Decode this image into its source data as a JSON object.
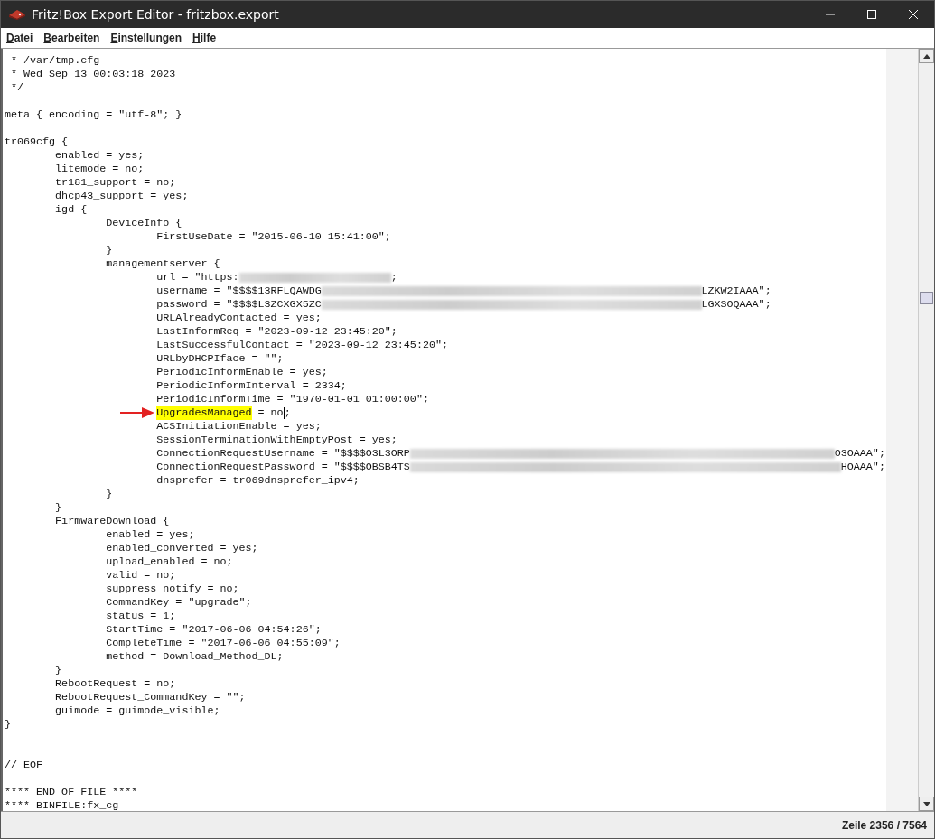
{
  "window": {
    "title": "Fritz!Box Export Editor - fritzbox.export"
  },
  "menu": [
    {
      "label": "Datei"
    },
    {
      "label": "Bearbeiten"
    },
    {
      "label": "Einstellungen"
    },
    {
      "label": "Hilfe"
    }
  ],
  "editor": {
    "lines": [
      {
        "kind": "code",
        "segments": [
          {
            "kind": "text",
            "text": " * /var/tmp.cfg"
          }
        ]
      },
      {
        "kind": "code",
        "segments": [
          {
            "kind": "text",
            "text": " * Wed Sep 13 00:03:18 2023"
          }
        ]
      },
      {
        "kind": "code",
        "segments": [
          {
            "kind": "text",
            "text": " */"
          }
        ]
      },
      {
        "kind": "blank"
      },
      {
        "kind": "code",
        "segments": [
          {
            "kind": "text",
            "text": "meta { encoding = \"utf-8\"; }"
          }
        ]
      },
      {
        "kind": "blank"
      },
      {
        "kind": "code",
        "segments": [
          {
            "kind": "text",
            "text": "tr069cfg {"
          }
        ]
      },
      {
        "kind": "code",
        "segments": [
          {
            "kind": "text",
            "text": "\tenabled = yes;"
          }
        ]
      },
      {
        "kind": "code",
        "segments": [
          {
            "kind": "text",
            "text": "\tlitemode = no;"
          }
        ]
      },
      {
        "kind": "code",
        "segments": [
          {
            "kind": "text",
            "text": "\ttr181_support = no;"
          }
        ]
      },
      {
        "kind": "code",
        "segments": [
          {
            "kind": "text",
            "text": "\tdhcp43_support = yes;"
          }
        ]
      },
      {
        "kind": "code",
        "segments": [
          {
            "kind": "text",
            "text": "\tigd {"
          }
        ]
      },
      {
        "kind": "code",
        "segments": [
          {
            "kind": "text",
            "text": "\t\tDeviceInfo {"
          }
        ]
      },
      {
        "kind": "code",
        "segments": [
          {
            "kind": "text",
            "text": "\t\t\tFirstUseDate = \"2015-06-10 15:41:00\";"
          }
        ]
      },
      {
        "kind": "code",
        "segments": [
          {
            "kind": "text",
            "text": "\t\t}"
          }
        ]
      },
      {
        "kind": "code",
        "segments": [
          {
            "kind": "text",
            "text": "\t\tmanagementserver {"
          }
        ]
      },
      {
        "kind": "code",
        "segments": [
          {
            "kind": "text",
            "text": "\t\t\turl = \"https:"
          },
          {
            "kind": "redacted"
          },
          {
            "kind": "text",
            "text": ";"
          }
        ]
      },
      {
        "kind": "code",
        "segments": [
          {
            "kind": "text",
            "text": "\t\t\tusername = \"$$$$13RFLQAWDG"
          },
          {
            "kind": "redacted"
          },
          {
            "kind": "text",
            "text": "LZKW2IAAA\";"
          }
        ]
      },
      {
        "kind": "code",
        "segments": [
          {
            "kind": "text",
            "text": "\t\t\tpassword = \"$$$$L3ZCXGX5ZC"
          },
          {
            "kind": "redacted"
          },
          {
            "kind": "text",
            "text": "LGXSOQAAA\";"
          }
        ]
      },
      {
        "kind": "code",
        "segments": [
          {
            "kind": "text",
            "text": "\t\t\tURLAlreadyContacted = yes;"
          }
        ]
      },
      {
        "kind": "code",
        "segments": [
          {
            "kind": "text",
            "text": "\t\t\tLastInformReq = \"2023-09-12 23:45:20\";"
          }
        ]
      },
      {
        "kind": "code",
        "segments": [
          {
            "kind": "text",
            "text": "\t\t\tLastSuccessfulContact = \"2023-09-12 23:45:20\";"
          }
        ]
      },
      {
        "kind": "code",
        "segments": [
          {
            "kind": "text",
            "text": "\t\t\tURLbyDHCPIface = \"\";"
          }
        ]
      },
      {
        "kind": "code",
        "segments": [
          {
            "kind": "text",
            "text": "\t\t\tPeriodicInformEnable = yes;"
          }
        ]
      },
      {
        "kind": "code",
        "segments": [
          {
            "kind": "text",
            "text": "\t\t\tPeriodicInformInterval = 2334;"
          }
        ]
      },
      {
        "kind": "code",
        "segments": [
          {
            "kind": "text",
            "text": "\t\t\tPeriodicInformTime = \"1970-01-01 01:00:00\";"
          }
        ]
      },
      {
        "kind": "code",
        "arrow": true,
        "segments": [
          {
            "kind": "tab"
          },
          {
            "kind": "tab"
          },
          {
            "kind": "tab"
          },
          {
            "kind": "highlight",
            "text": "UpgradesManaged"
          },
          {
            "kind": "text",
            "text": " = no"
          },
          {
            "kind": "caret"
          },
          {
            "kind": "text",
            "text": ";"
          }
        ]
      },
      {
        "kind": "code",
        "segments": [
          {
            "kind": "text",
            "text": "\t\t\tACSInitiationEnable = yes;"
          }
        ]
      },
      {
        "kind": "code",
        "segments": [
          {
            "kind": "text",
            "text": "\t\t\tSessionTerminationWithEmptyPost = yes;"
          }
        ]
      },
      {
        "kind": "code",
        "segments": [
          {
            "kind": "text",
            "text": "\t\t\tConnectionRequestUsername = \"$$$$O3L3ORP"
          },
          {
            "kind": "redacted"
          },
          {
            "kind": "text",
            "text": "O3OAAA\";"
          }
        ]
      },
      {
        "kind": "code",
        "segments": [
          {
            "kind": "text",
            "text": "\t\t\tConnectionRequestPassword = \"$$$$OBSB4TS"
          },
          {
            "kind": "redacted"
          },
          {
            "kind": "text",
            "text": "HOAAA\";"
          }
        ]
      },
      {
        "kind": "code",
        "segments": [
          {
            "kind": "text",
            "text": "\t\t\tdnsprefer = tr069dnsprefer_ipv4;"
          }
        ]
      },
      {
        "kind": "code",
        "segments": [
          {
            "kind": "text",
            "text": "\t\t}"
          }
        ]
      },
      {
        "kind": "code",
        "segments": [
          {
            "kind": "text",
            "text": "\t}"
          }
        ]
      },
      {
        "kind": "code",
        "segments": [
          {
            "kind": "text",
            "text": "\tFirmwareDownload {"
          }
        ]
      },
      {
        "kind": "code",
        "segments": [
          {
            "kind": "text",
            "text": "\t\tenabled = yes;"
          }
        ]
      },
      {
        "kind": "code",
        "segments": [
          {
            "kind": "text",
            "text": "\t\tenabled_converted = yes;"
          }
        ]
      },
      {
        "kind": "code",
        "segments": [
          {
            "kind": "text",
            "text": "\t\tupload_enabled = no;"
          }
        ]
      },
      {
        "kind": "code",
        "segments": [
          {
            "kind": "text",
            "text": "\t\tvalid = no;"
          }
        ]
      },
      {
        "kind": "code",
        "segments": [
          {
            "kind": "text",
            "text": "\t\tsuppress_notify = no;"
          }
        ]
      },
      {
        "kind": "code",
        "segments": [
          {
            "kind": "text",
            "text": "\t\tCommandKey = \"upgrade\";"
          }
        ]
      },
      {
        "kind": "code",
        "segments": [
          {
            "kind": "text",
            "text": "\t\tstatus = 1;"
          }
        ]
      },
      {
        "kind": "code",
        "segments": [
          {
            "kind": "text",
            "text": "\t\tStartTime = \"2017-06-06 04:54:26\";"
          }
        ]
      },
      {
        "kind": "code",
        "segments": [
          {
            "kind": "text",
            "text": "\t\tCompleteTime = \"2017-06-06 04:55:09\";"
          }
        ]
      },
      {
        "kind": "code",
        "segments": [
          {
            "kind": "text",
            "text": "\t\tmethod = Download_Method_DL;"
          }
        ]
      },
      {
        "kind": "code",
        "segments": [
          {
            "kind": "text",
            "text": "\t}"
          }
        ]
      },
      {
        "kind": "code",
        "segments": [
          {
            "kind": "text",
            "text": "\tRebootRequest = no;"
          }
        ]
      },
      {
        "kind": "code",
        "segments": [
          {
            "kind": "text",
            "text": "\tRebootRequest_CommandKey = \"\";"
          }
        ]
      },
      {
        "kind": "code",
        "segments": [
          {
            "kind": "text",
            "text": "\tguimode = guimode_visible;"
          }
        ]
      },
      {
        "kind": "code",
        "segments": [
          {
            "kind": "text",
            "text": "}"
          }
        ]
      },
      {
        "kind": "blank"
      },
      {
        "kind": "blank"
      },
      {
        "kind": "code",
        "segments": [
          {
            "kind": "text",
            "text": "// EOF"
          }
        ]
      },
      {
        "kind": "blank"
      },
      {
        "kind": "code",
        "segments": [
          {
            "kind": "text",
            "text": "**** END OF FILE ****"
          }
        ]
      },
      {
        "kind": "code",
        "segments": [
          {
            "kind": "text",
            "text": "**** BINFILE:fx_cg"
          }
        ]
      }
    ]
  },
  "status_bar": {
    "position": "Zeile 2356 / 7564"
  }
}
